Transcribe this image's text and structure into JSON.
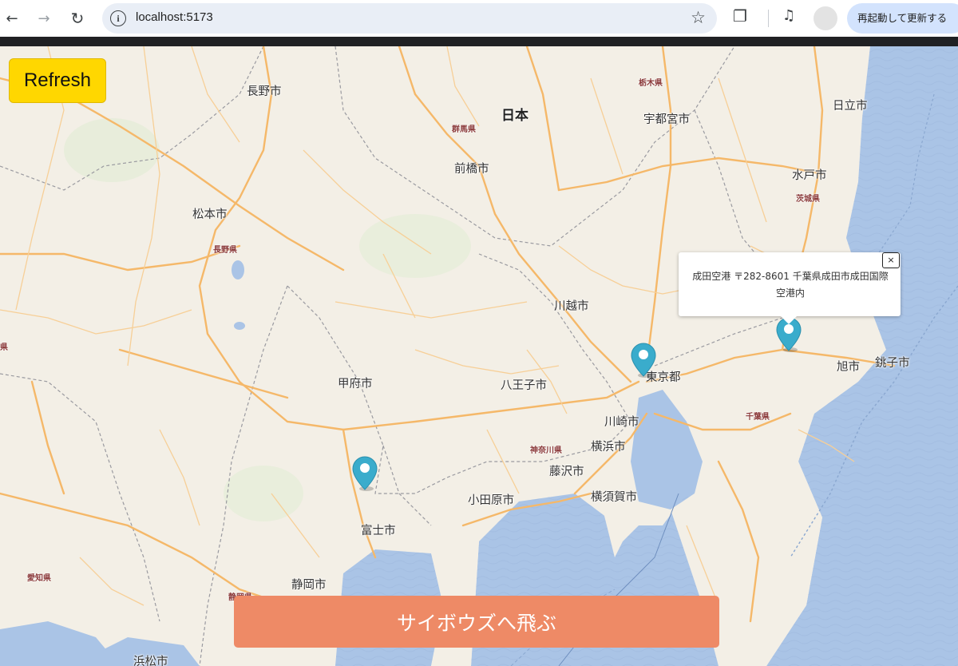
{
  "browser": {
    "url": "localhost:5173",
    "update_label": "再起動して更新する",
    "icons": {
      "back": "back-arrow-icon",
      "forward": "forward-arrow-icon",
      "reload": "reload-icon",
      "info": "info-icon",
      "star": "bookmark-star-icon",
      "extensions": "puzzle-icon",
      "media": "media-queue-icon"
    }
  },
  "map": {
    "country": "日本",
    "cities": [
      "長野市",
      "宇都宮市",
      "日立市",
      "前橋市",
      "水戸市",
      "松本市",
      "川越市",
      "甲府市",
      "八王子市",
      "東京都",
      "旭市",
      "銚子市",
      "川崎市",
      "横浜市",
      "藤沢市",
      "小田原市",
      "横須賀市",
      "富士市",
      "静岡市",
      "浜松市"
    ],
    "prefectures": [
      "栃木県",
      "群馬県",
      "茨城県",
      "長野県",
      "千葉県",
      "神奈川県",
      "愛知県",
      "静岡県",
      "県"
    ],
    "colors": {
      "land": "#f3efe6",
      "sea": "#aac4e6",
      "road": "#f7c07a",
      "marker": "#3aaccc",
      "refresh_button": "#ffd700",
      "jump_button": "#ee8a66"
    }
  },
  "refresh_label": "Refresh",
  "popup": {
    "text": "成田空港 〒282-8601 千葉県成田市成田国際空港内",
    "close_label": "×"
  },
  "jump_label": "サイボウズへ飛ぶ"
}
